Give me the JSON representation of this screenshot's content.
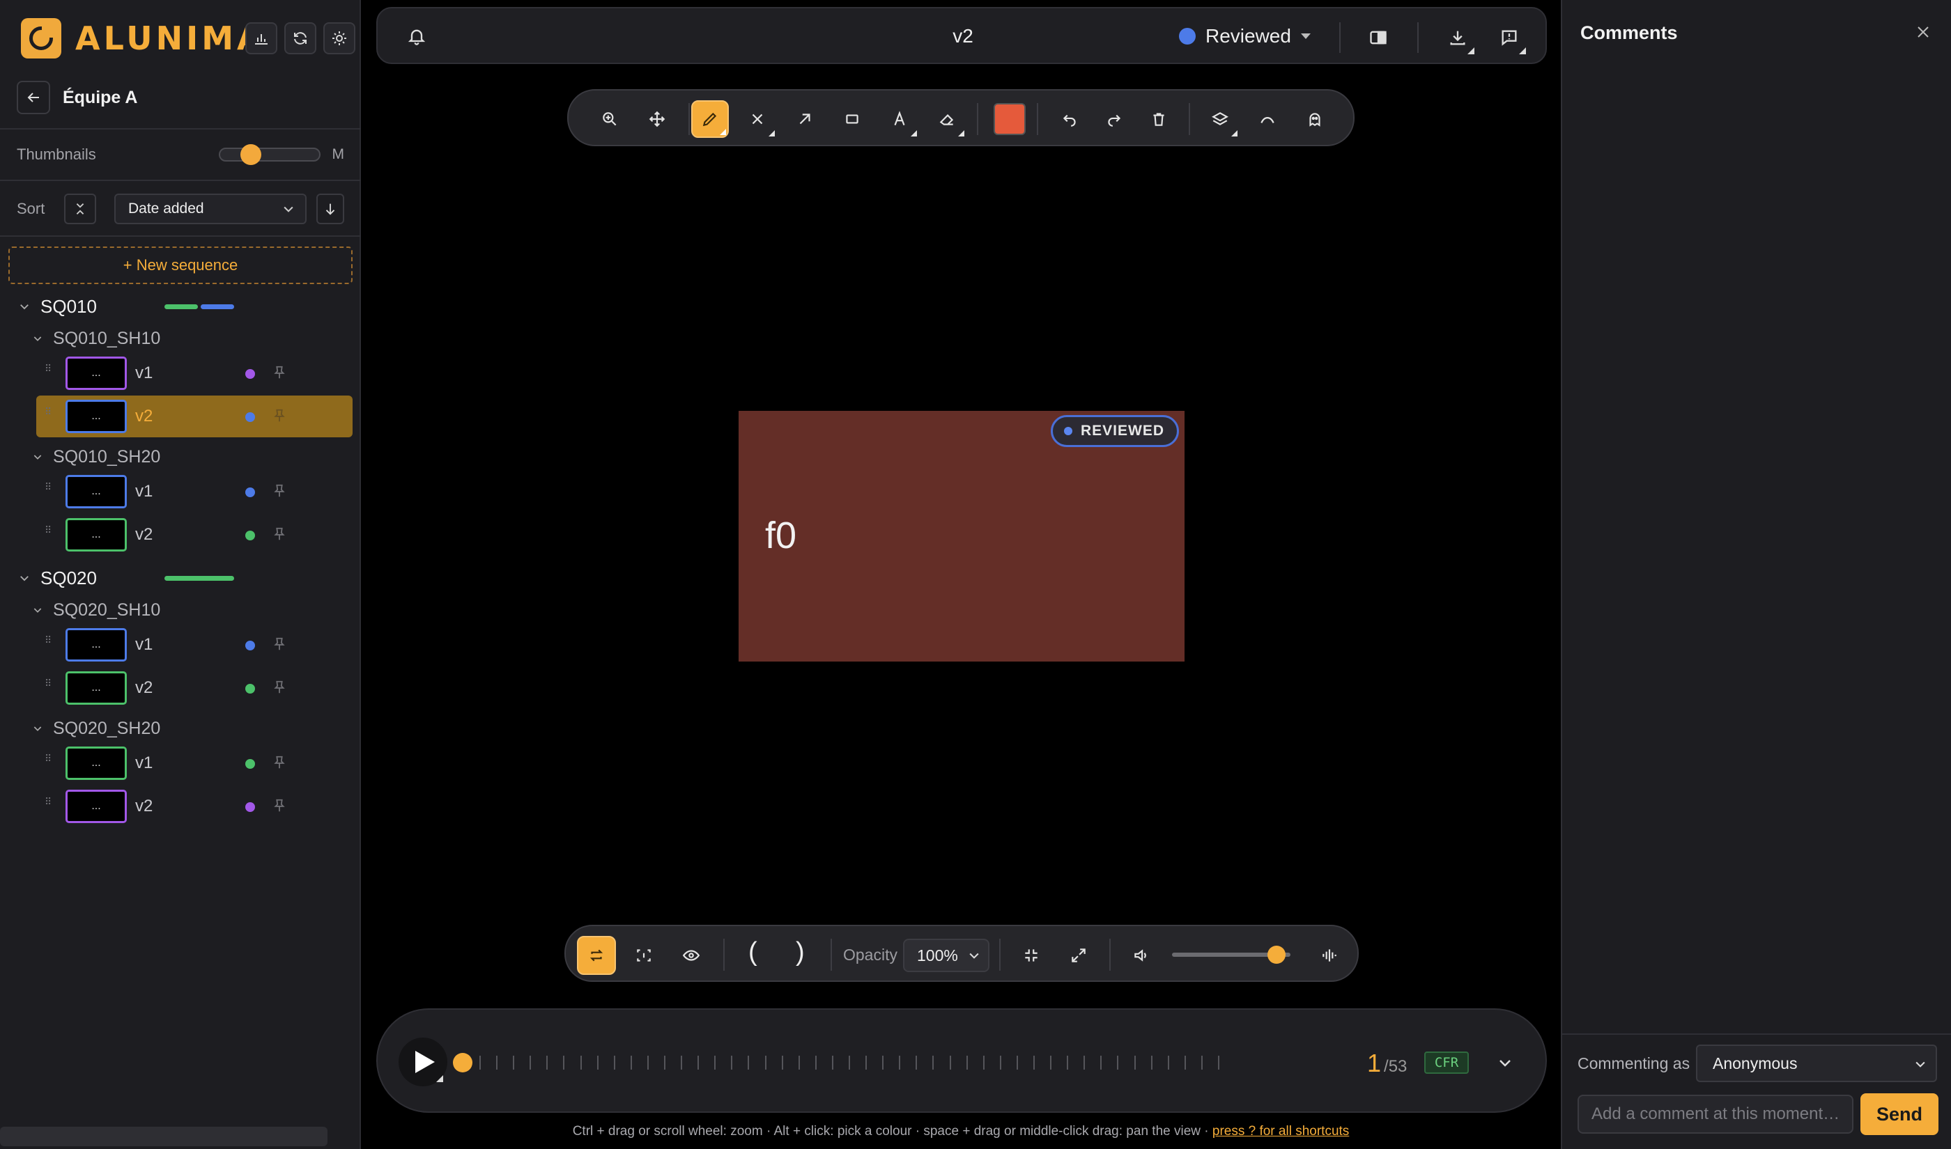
{
  "app": {
    "brand": "ALUNIMA",
    "toolbar_icons": [
      "chart-icon",
      "refresh-icon",
      "sun-icon"
    ]
  },
  "sidebar": {
    "team_name": "Équipe A",
    "thumbnails": {
      "label": "Thumbnails",
      "size": "M",
      "slider_level_fraction": 0.25
    },
    "sort": {
      "label": "Sort",
      "selected": "Date added"
    },
    "new_sequence_label": "+ New sequence",
    "sequences": [
      {
        "name": "SQ010",
        "progress_colors": [
          "#4cc16a",
          "#4d7be8"
        ],
        "shots": [
          {
            "name": "SQ010_SH10",
            "versions": [
              {
                "name": "v1",
                "thumb": "...",
                "status_color": "#a258e8",
                "active": false
              },
              {
                "name": "v2",
                "thumb": "...",
                "status_color": "#4d7be8",
                "active": true
              }
            ]
          },
          {
            "name": "SQ010_SH20",
            "versions": [
              {
                "name": "v1",
                "thumb": "...",
                "status_color": "#4d7be8",
                "active": false
              },
              {
                "name": "v2",
                "thumb": "...",
                "status_color": "#4cc16a",
                "active": false
              }
            ]
          }
        ]
      },
      {
        "name": "SQ020",
        "progress_colors": [
          "#4cc16a"
        ],
        "shots": [
          {
            "name": "SQ020_SH10",
            "versions": [
              {
                "name": "v1",
                "thumb": "...",
                "status_color": "#4d7be8",
                "active": false
              },
              {
                "name": "v2",
                "thumb": "...",
                "status_color": "#4cc16a",
                "active": false
              }
            ]
          },
          {
            "name": "SQ020_SH20",
            "versions": [
              {
                "name": "v1",
                "thumb": "...",
                "status_color": "#4cc16a",
                "active": false
              },
              {
                "name": "v2",
                "thumb": "...",
                "status_color": "#a258e8",
                "active": false
              }
            ]
          }
        ]
      }
    ]
  },
  "topbar": {
    "title": "v2",
    "status": "Reviewed",
    "status_color": "#4d7be8"
  },
  "viewer": {
    "frame_label": "f0",
    "badge": "REVIEWED",
    "frame_color": "#642e27",
    "draw_color": "#e55a3b"
  },
  "viewbar": {
    "in_mark": "(",
    "out_mark": ")",
    "opacity_label": "Opacity",
    "opacity_value": "100%",
    "volume_fraction": 0.88
  },
  "player": {
    "current_frame": "1",
    "total_frames": "/53",
    "rate_badge": "CFR",
    "position_fraction": 0.0
  },
  "hint": {
    "text": "Ctrl + drag or scroll wheel: zoom · Alt + click: pick a colour · space + drag or middle-click drag: pan the view · ",
    "link": "press ? for all shortcuts"
  },
  "comments": {
    "title": "Comments",
    "commenting_as_label": "Commenting as",
    "user": "Anonymous",
    "input_placeholder": "Add a comment at this moment…",
    "send_label": "Send"
  },
  "colors": {
    "accent": "#f5ad3a",
    "blue": "#4d7be8",
    "green": "#4cc16a",
    "purple": "#a258e8"
  }
}
